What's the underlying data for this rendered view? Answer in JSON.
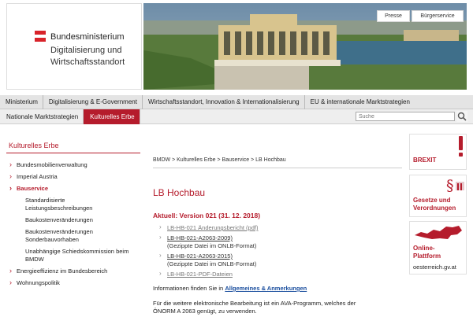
{
  "header": {
    "logo": {
      "line1": "Bundesministerium",
      "line2": "Digitalisierung und",
      "line3": "Wirtschaftsstandort",
      "flag_colors": [
        "#d8232a",
        "#ffffff",
        "#d8232a"
      ]
    },
    "top_links": [
      "Presse",
      "Bürgerservice"
    ]
  },
  "nav_primary": [
    "Ministerium",
    "Digitalisierung & E-Government",
    "Wirtschaftsstandort, Innovation & Internationalisierung",
    "EU & internationale Marktstrategien"
  ],
  "nav_secondary": [
    {
      "label": "Nationale Marktstrategien",
      "active": false
    },
    {
      "label": "Kulturelles Erbe",
      "active": true
    }
  ],
  "search": {
    "placeholder": "Suche"
  },
  "sidebar": {
    "heading": "Kulturelles Erbe",
    "items": [
      {
        "label": "Bundesmobilienverwaltung"
      },
      {
        "label": "Imperial Austria"
      },
      {
        "label": "Bauservice",
        "active": true
      },
      {
        "label": "Energieeffizienz im Bundesbereich"
      },
      {
        "label": "Wohnungspolitik"
      }
    ],
    "subitems": [
      [
        "Standardisierte",
        "Leistungsbeschreibungen"
      ],
      [
        "Baukostenveränderungen"
      ],
      [
        "Baukostenveränderungen",
        "Sonderbauvorhaben"
      ],
      [
        "Unabhängige Schiedskommission beim",
        "BMDW"
      ]
    ]
  },
  "main": {
    "breadcrumb": "BMDW > Kulturelles Erbe > Bauservice > LB Hochbau",
    "title": "LB Hochbau",
    "aktuell": "Aktuell: Version 021 (31. 12. 2018)",
    "files": [
      {
        "link": "LB-HB-021 Änderungsbericht (pdf)",
        "note": ""
      },
      {
        "link": "LB-HB-021-A2063-2009)",
        "note": "(Gezippte Datei im ONLB-Format)"
      },
      {
        "link": "LB-HB-021-A2063-2015)",
        "note": "(Gezippte Datei im ONLB-Format)"
      },
      {
        "link": "LB-HB-021-PDF-Dateien",
        "note": ""
      }
    ],
    "info_prefix": "Informationen finden Sie in ",
    "info_link": "Allgemeines & Anmerkungen",
    "paragraph_line1": "Für die weitere elektronische Bearbeitung ist ein AVA-Programm, welches der",
    "paragraph_line2": "ÖNORM A 2063 genügt, zu verwenden."
  },
  "right_boxes": {
    "brexit": "BREXIT",
    "gesetze_line1": "Gesetze und",
    "gesetze_line2": "Verordnungen",
    "online_line1": "Online-",
    "online_line2": "Plattform",
    "online_url": "oesterreich.gv.at"
  },
  "colors": {
    "accent": "#b51c2c",
    "nav_bg": "#e4e4e4",
    "link": "#1a4e9e"
  },
  "icons": [
    "exclamation-icon",
    "paragraph-icon",
    "austria-map-icon",
    "search-icon"
  ]
}
